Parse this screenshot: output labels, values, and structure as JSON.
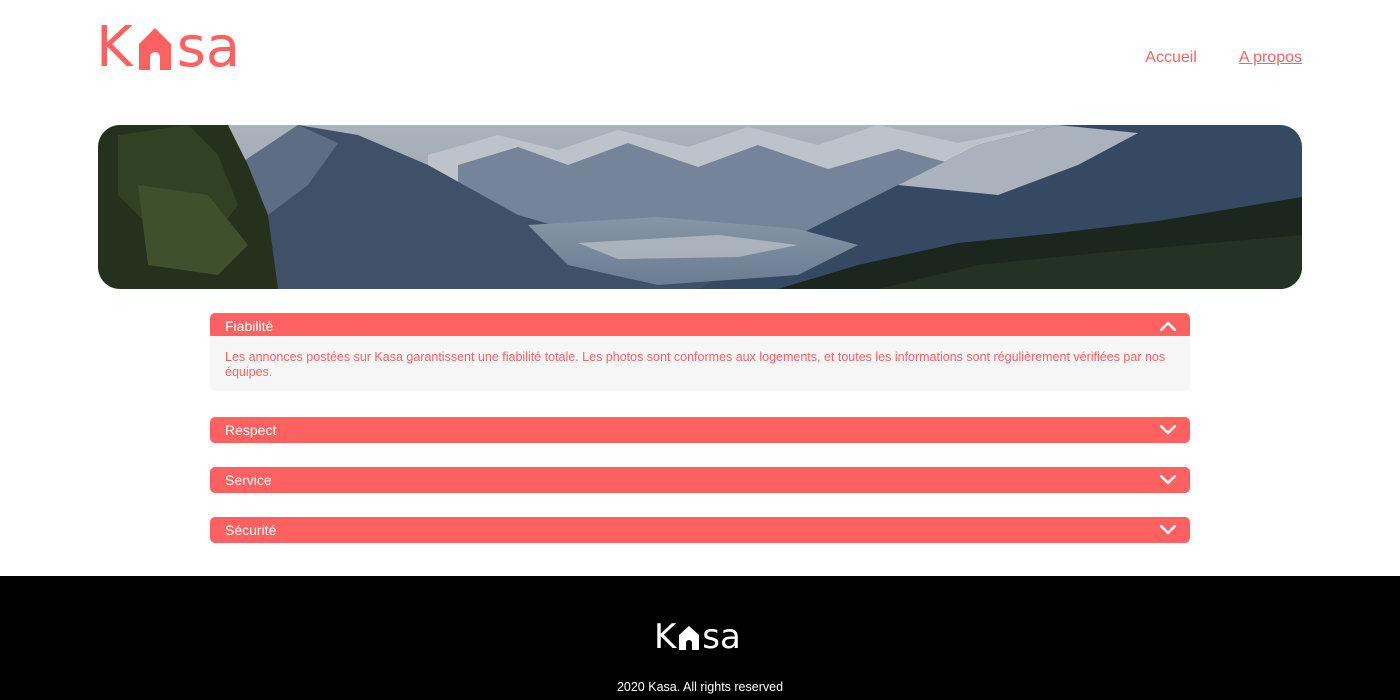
{
  "header": {
    "logo": {
      "text_before": "K",
      "text_after": "sa",
      "icon": "house-icon"
    },
    "nav": [
      {
        "label": "Accueil",
        "active": false
      },
      {
        "label": "A propos",
        "active": true
      }
    ]
  },
  "banner": {
    "description_icon": "mountain-landscape-image"
  },
  "accordions": [
    {
      "title": "Fiabilité",
      "open": true,
      "content": "Les annonces postées sur Kasa garantissent une fiabilité totale. Les photos sont conformes aux logements, et toutes les informations sont régulièrement vérifiées par nos équipes."
    },
    {
      "title": "Respect",
      "open": false
    },
    {
      "title": "Service",
      "open": false
    },
    {
      "title": "Sécurité",
      "open": false
    }
  ],
  "footer": {
    "logo": {
      "text_before": "K",
      "text_after": "sa"
    },
    "copyright": "2020 Kasa. All rights reserved"
  },
  "colors": {
    "brand": "#FF6060",
    "panel": "#F6F6F6",
    "footer_bg": "#000000"
  }
}
